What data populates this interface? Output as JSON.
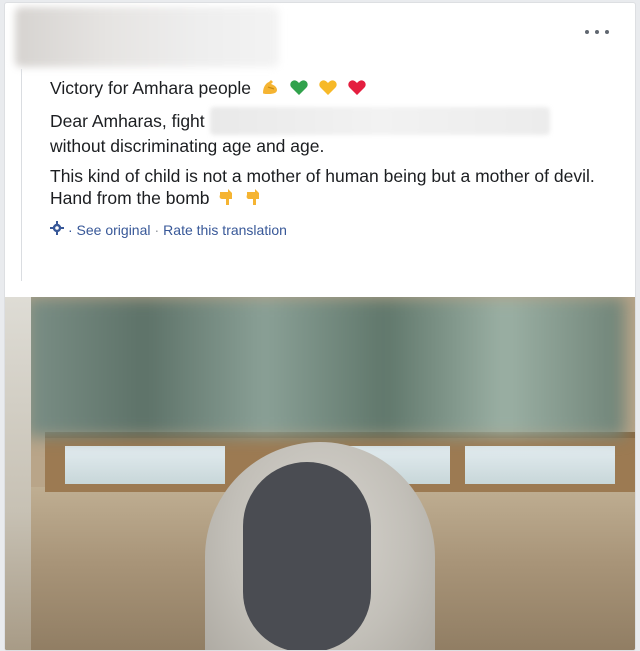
{
  "post": {
    "more_label": "•••",
    "lines": {
      "title": "Victory for Amhara people",
      "line2_prefix": "Dear Amharas, fight",
      "line3": "without discriminating age and age.",
      "line4": "This kind of child is not a mother of human being but a mother of devil.",
      "line5": "Hand from the bomb"
    },
    "emoji": {
      "title": [
        "flexed-biceps-icon",
        "green-heart-icon",
        "yellow-heart-icon",
        "red-heart-icon"
      ],
      "line5": [
        "pointing-down-icon",
        "pointing-down-icon"
      ]
    }
  },
  "translation": {
    "see_original": "· See original",
    "separator": "·",
    "rate": "Rate this translation"
  },
  "colors": {
    "link": "#385898",
    "green_heart": "#31a24c",
    "yellow_heart": "#f7b928",
    "red_heart": "#e41e3f",
    "hand": "#f5b432"
  }
}
